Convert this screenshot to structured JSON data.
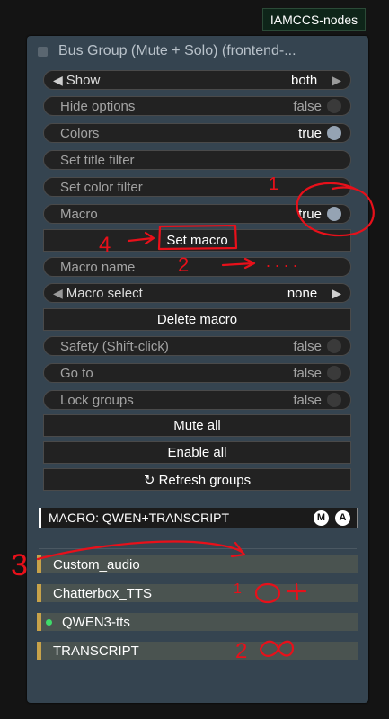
{
  "badge": "IAMCCS-nodes",
  "node": {
    "title": "Bus Group (Mute + Solo) (frontend-..."
  },
  "widgets": {
    "show": {
      "label": "Show",
      "value": "both"
    },
    "hide_options": {
      "label": "Hide options",
      "value": "false"
    },
    "colors": {
      "label": "Colors",
      "value": "true"
    },
    "set_title_filter": {
      "label": "Set title filter"
    },
    "set_color_filter": {
      "label": "Set color filter"
    },
    "macro": {
      "label": "Macro",
      "value": "true"
    },
    "set_macro": {
      "label": "Set macro"
    },
    "macro_name": {
      "label": "Macro name"
    },
    "macro_select": {
      "label": "Macro select",
      "value": "none"
    },
    "delete_macro": {
      "label": "Delete macro"
    },
    "safety": {
      "label": "Safety (Shift-click)",
      "value": "false"
    },
    "go_to": {
      "label": "Go to",
      "value": "false"
    },
    "lock_groups": {
      "label": "Lock groups",
      "value": "false"
    },
    "mute_all": {
      "label": "Mute all"
    },
    "enable_all": {
      "label": "Enable all"
    },
    "refresh_groups": {
      "label": "↻ Refresh groups"
    }
  },
  "macro_bar": {
    "label": "MACRO: QWEN+TRANSCRIPT",
    "btn_m": "M",
    "btn_a": "A"
  },
  "groups": [
    {
      "name": "Custom_audio"
    },
    {
      "name": "Chatterbox_TTS"
    },
    {
      "name": "QWEN3-tts",
      "active": true
    },
    {
      "name": "TRANSCRIPT"
    }
  ],
  "annotations": {
    "color": "#e8101a",
    "n1": "1",
    "n2a": "2",
    "n3": "3",
    "n4": "4",
    "n1b": "1",
    "n2b": "2",
    "dots": ". . . ."
  }
}
